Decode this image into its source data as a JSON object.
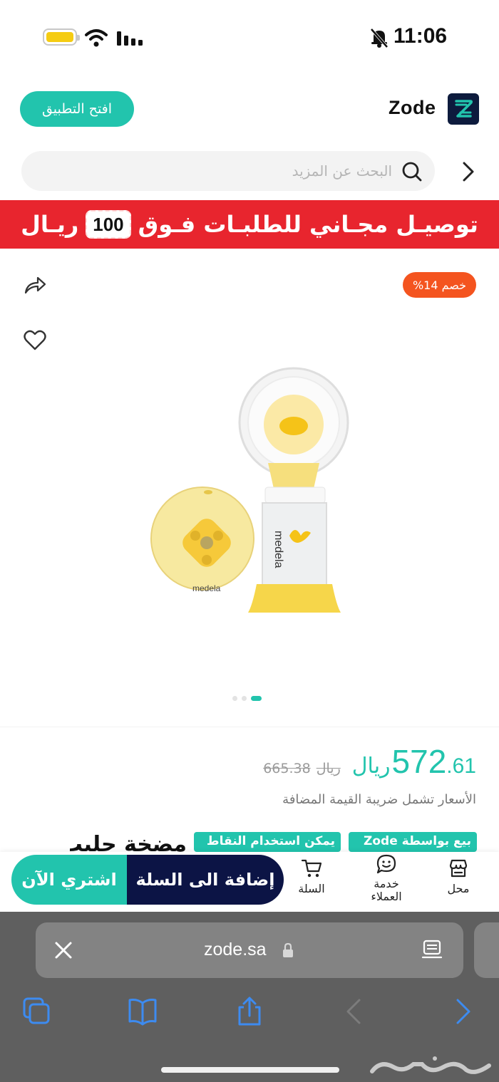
{
  "status_bar": {
    "time": "11:06"
  },
  "header": {
    "open_app_label": "افتح التطبيق",
    "brand_name": "Zode"
  },
  "search": {
    "placeholder": "البحث عن المزيد"
  },
  "banner": {
    "text_before": "توصيـل مجـاني للطلبـات فـوق",
    "amount": "100",
    "currency": "ريـال"
  },
  "product": {
    "discount_badge": "خصم 14%",
    "price_currency": "ريال",
    "price_whole": "572",
    "price_fraction": ".61",
    "old_price_currency": "ريال",
    "old_price": "665.38",
    "vat_note": "الأسعار تشمل ضريبة القيمة المضافة",
    "tag_seller": "بيع بواسطة Zode",
    "tag_points": "يمكن استخدام النقاط",
    "title_partial": "مضخة حليب",
    "carousel": {
      "count": 3,
      "active": 3
    }
  },
  "bottom_bar": {
    "buy_now": "اشتري الآن",
    "add_to_cart": "إضافة الى السلة",
    "nav_cart": "السلة",
    "nav_support_line1": "خدمة",
    "nav_support_line2": "العملاء",
    "nav_store": "محل"
  },
  "browser": {
    "url": "zode.sa"
  },
  "colors": {
    "accent": "#22c4ad",
    "banner_red": "#e8252e",
    "discount_orange": "#f4541f",
    "navy": "#0c1445"
  }
}
